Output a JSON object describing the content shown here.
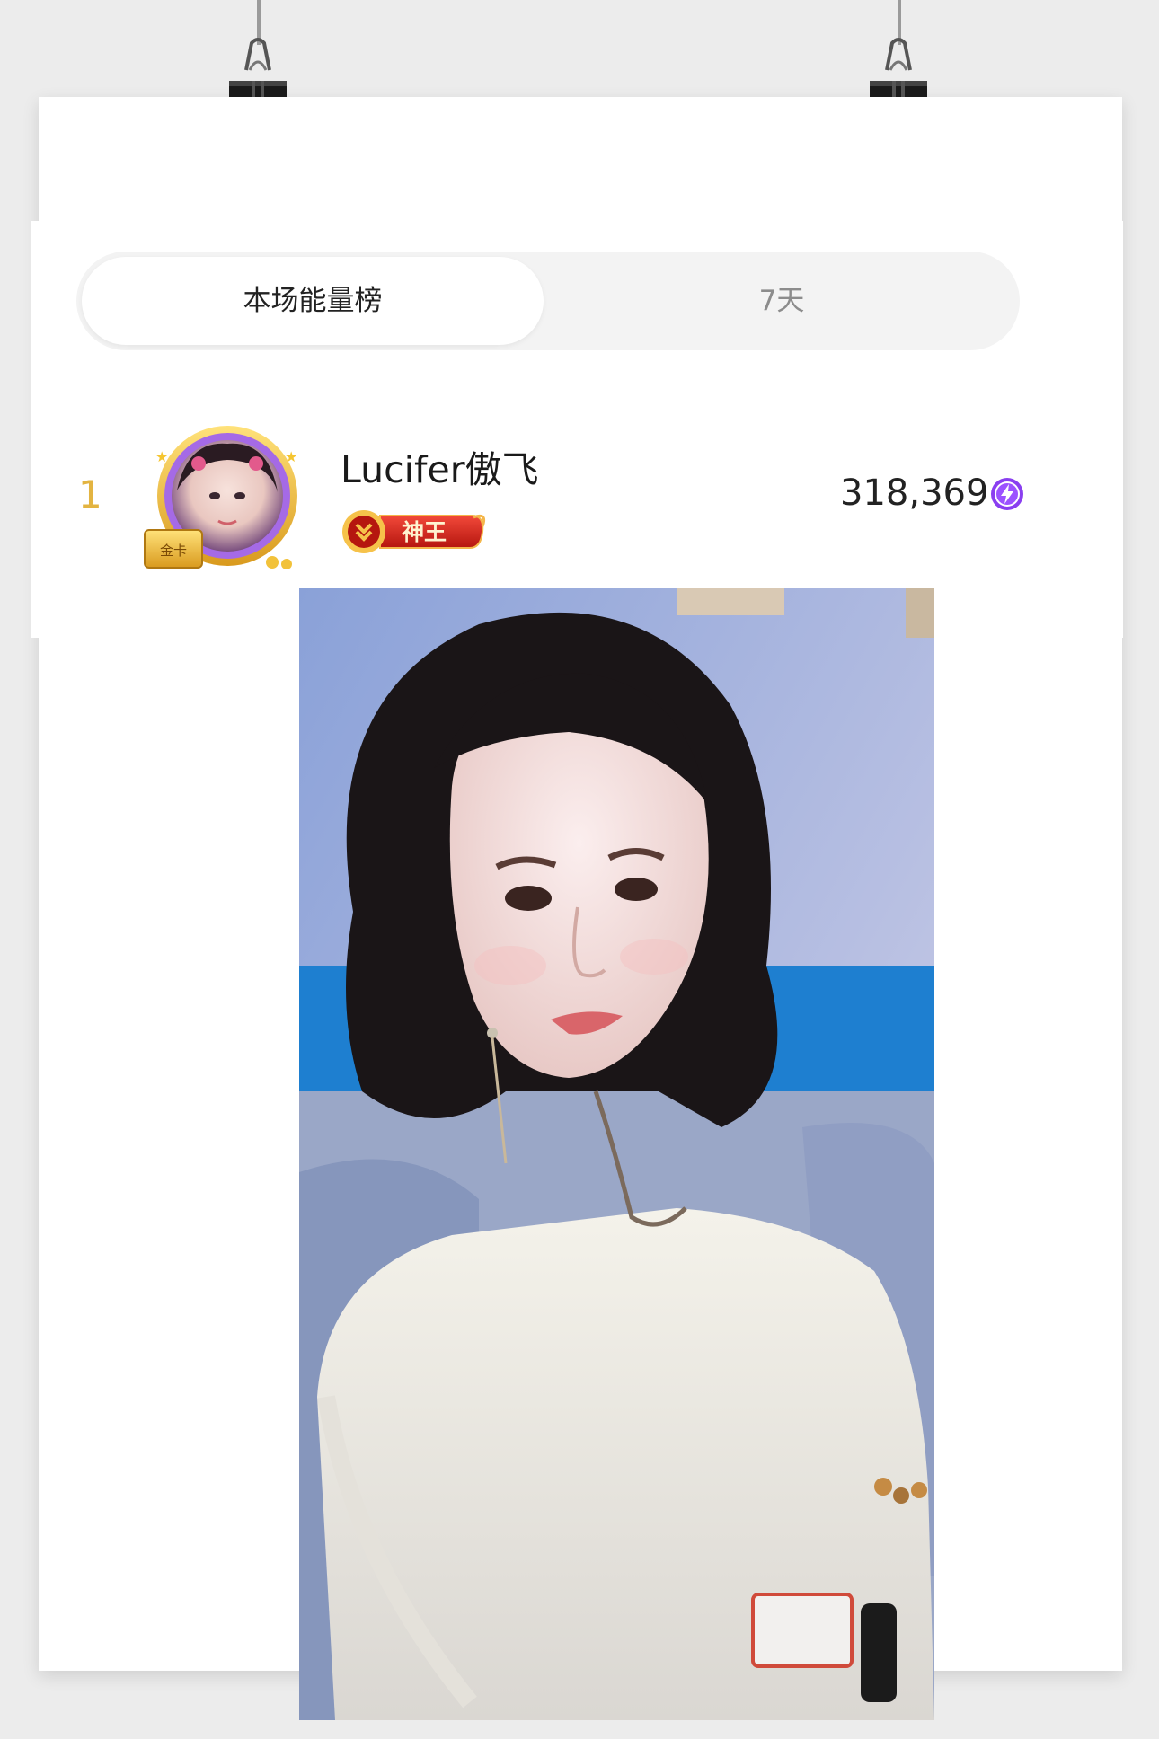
{
  "tabs": [
    {
      "label": "本场能量榜",
      "active": true
    },
    {
      "label": "7天",
      "active": false
    }
  ],
  "ranking": [
    {
      "rank": "1",
      "username": "Lucifer傲飞",
      "badge_label": "神王",
      "avatar_card_label": "金卡",
      "score": "318,369",
      "score_icon": "energy-bolt-icon"
    }
  ],
  "colors": {
    "rank_gold": "#e3b441",
    "tab_bg": "#f3f3f3",
    "badge_red": "#d9261c",
    "energy_purple": "#8a3ff0",
    "avatar_ring": "#9a5de0"
  },
  "decoration": {
    "clips": [
      "binder-clip-icon",
      "binder-clip-icon"
    ],
    "photo": "portrait-photo"
  }
}
